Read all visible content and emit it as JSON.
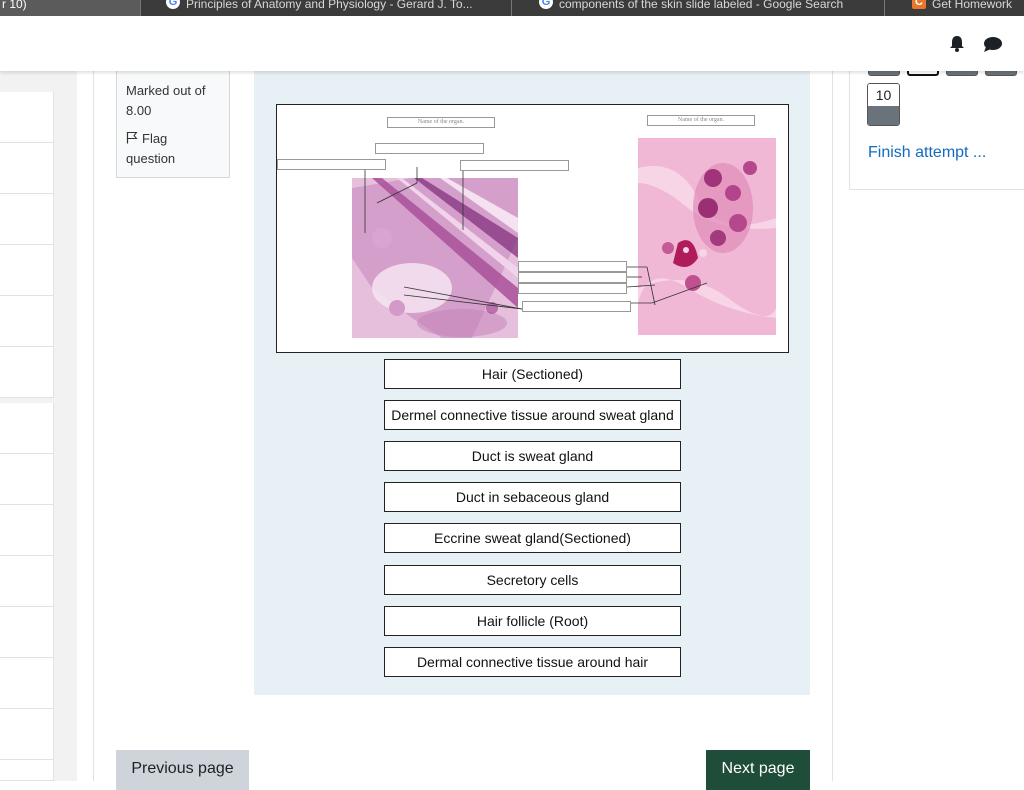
{
  "browser": {
    "tabs": [
      {
        "title": "r 10)"
      },
      {
        "title": "Principles of Anatomy and Physiology - Gerard J. To..."
      },
      {
        "title": "components of the skin slide labeled - Google Search"
      },
      {
        "title": "Get Homework"
      }
    ]
  },
  "header": {
    "icons": [
      "bell-icon",
      "chat-icon"
    ]
  },
  "question_info": {
    "marked_out_of": "Marked out of 8.00",
    "flag_label": "Flag question"
  },
  "diagram": {
    "organ_name_placeholder_left": "Name of the organ.",
    "organ_name_placeholder_right": "Name of the organ."
  },
  "choices": [
    "Hair (Sectioned)",
    "Dermel connective tissue around sweat gland",
    "Duct is sweat gland",
    "Duct in sebaceous gland",
    "Eccrine sweat gland(Sectioned)",
    "Secretory cells",
    "Hair follicle (Root)",
    "Dermal connective tissue around hair"
  ],
  "navigation": {
    "previous_label": "Previous page",
    "next_label": "Next page"
  },
  "quiz_nav": {
    "current_question_number": "10",
    "finish_label": "Finish attempt ..."
  },
  "colors": {
    "question_bg": "#e7f0f4",
    "next_button": "#1e4d3a",
    "link": "#0f6cbf",
    "nav_fill": "#6a737b"
  }
}
